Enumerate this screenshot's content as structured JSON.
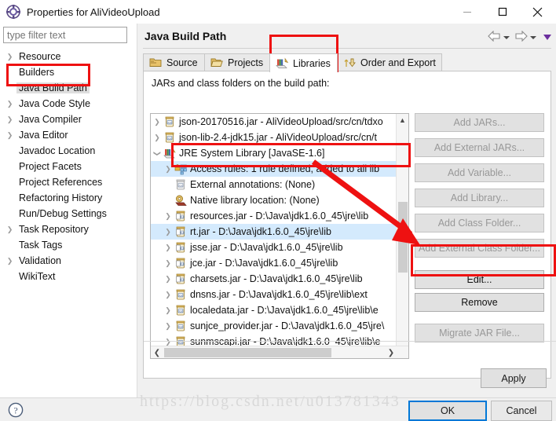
{
  "window": {
    "title": "Properties for AliVideoUpload",
    "icon": "eclipse-properties-icon",
    "minimize_label": "—",
    "maximize_label": "☐",
    "close_label": "✕"
  },
  "sidebar": {
    "filter": {
      "value": "",
      "placeholder": "type filter text"
    },
    "items": [
      {
        "label": "Resource",
        "expandable": true,
        "selected": false
      },
      {
        "label": "Builders",
        "expandable": false,
        "selected": false
      },
      {
        "label": "Java Build Path",
        "expandable": false,
        "selected": true
      },
      {
        "label": "Java Code Style",
        "expandable": true,
        "selected": false
      },
      {
        "label": "Java Compiler",
        "expandable": true,
        "selected": false
      },
      {
        "label": "Java Editor",
        "expandable": true,
        "selected": false
      },
      {
        "label": "Javadoc Location",
        "expandable": false,
        "selected": false
      },
      {
        "label": "Project Facets",
        "expandable": false,
        "selected": false
      },
      {
        "label": "Project References",
        "expandable": false,
        "selected": false
      },
      {
        "label": "Refactoring History",
        "expandable": false,
        "selected": false
      },
      {
        "label": "Run/Debug Settings",
        "expandable": false,
        "selected": false
      },
      {
        "label": "Task Repository",
        "expandable": true,
        "selected": false
      },
      {
        "label": "Task Tags",
        "expandable": false,
        "selected": false
      },
      {
        "label": "Validation",
        "expandable": true,
        "selected": false
      },
      {
        "label": "WikiText",
        "expandable": false,
        "selected": false
      }
    ]
  },
  "page": {
    "title": "Java Build Path",
    "nav": {
      "back_icon": "back-arrow-icon",
      "back_menu_icon": "chevron-down-icon",
      "forward_icon": "forward-arrow-icon",
      "forward_menu_icon": "chevron-down-icon",
      "menu_icon": "purple-triangle-icon"
    },
    "tabs": [
      {
        "label": "Source",
        "icon": "source-folder-icon",
        "active": false
      },
      {
        "label": "Projects",
        "icon": "projects-folder-icon",
        "active": false
      },
      {
        "label": "Libraries",
        "icon": "libraries-books-icon",
        "active": true
      },
      {
        "label": "Order and Export",
        "icon": "order-export-icon",
        "active": false
      }
    ],
    "panel_label": "JARs and class folders on the build path:",
    "list": [
      {
        "text": "json-20170516.jar - AliVideoUpload/src/cn/tdxo",
        "icon": "jar-icon",
        "expandable": true,
        "indent": 0,
        "highlight": false
      },
      {
        "text": "json-lib-2.4-jdk15.jar - AliVideoUpload/src/cn/t",
        "icon": "jar-icon",
        "expandable": true,
        "indent": 0,
        "highlight": false
      },
      {
        "text": "JRE System Library [JavaSE-1.6]",
        "icon": "library-icon",
        "expandable": true,
        "indent": 0,
        "highlight": false,
        "expanded": true
      },
      {
        "text": "Access rules: 1 rule defined, added to all lib",
        "icon": "access-rules-icon",
        "expandable": true,
        "indent": 1,
        "highlight": true
      },
      {
        "text": "External annotations: (None)",
        "icon": "annotations-icon",
        "expandable": false,
        "indent": 1,
        "highlight": false
      },
      {
        "text": "Native library location: (None)",
        "icon": "native-library-icon",
        "expandable": false,
        "indent": 1,
        "highlight": false
      },
      {
        "text": "resources.jar - D:\\Java\\jdk1.6.0_45\\jre\\lib",
        "icon": "jar-src-icon",
        "expandable": true,
        "indent": 1,
        "highlight": false
      },
      {
        "text": "rt.jar - D:\\Java\\jdk1.6.0_45\\jre\\lib",
        "icon": "jar-src-icon",
        "expandable": true,
        "indent": 1,
        "highlight": true
      },
      {
        "text": "jsse.jar - D:\\Java\\jdk1.6.0_45\\jre\\lib",
        "icon": "jar-src-icon",
        "expandable": true,
        "indent": 1,
        "highlight": false
      },
      {
        "text": "jce.jar - D:\\Java\\jdk1.6.0_45\\jre\\lib",
        "icon": "jar-src-icon",
        "expandable": true,
        "indent": 1,
        "highlight": false
      },
      {
        "text": "charsets.jar - D:\\Java\\jdk1.6.0_45\\jre\\lib",
        "icon": "jar-src-icon",
        "expandable": true,
        "indent": 1,
        "highlight": false
      },
      {
        "text": "dnsns.jar - D:\\Java\\jdk1.6.0_45\\jre\\lib\\ext",
        "icon": "jar-icon",
        "expandable": true,
        "indent": 1,
        "highlight": false
      },
      {
        "text": "localedata.jar - D:\\Java\\jdk1.6.0_45\\jre\\lib\\e",
        "icon": "jar-icon",
        "expandable": true,
        "indent": 1,
        "highlight": false
      },
      {
        "text": "sunjce_provider.jar - D:\\Java\\jdk1.6.0_45\\jre\\",
        "icon": "jar-icon",
        "expandable": true,
        "indent": 1,
        "highlight": false
      },
      {
        "text": "sunmscapi.jar - D:\\Java\\jdk1.6.0_45\\jre\\lib\\e",
        "icon": "jar-icon",
        "expandable": true,
        "indent": 1,
        "highlight": false
      }
    ],
    "side_buttons": [
      {
        "label": "Add JARs...",
        "enabled": false
      },
      {
        "label": "Add External JARs...",
        "enabled": false
      },
      {
        "label": "Add Variable...",
        "enabled": false
      },
      {
        "label": "Add Library...",
        "enabled": false
      },
      {
        "label": "Add Class Folder...",
        "enabled": false
      },
      {
        "label": "Add External Class Folder...",
        "enabled": false
      },
      {
        "label": "Edit...",
        "enabled": true
      },
      {
        "label": "Remove",
        "enabled": true
      },
      {
        "label": "Migrate JAR File...",
        "enabled": false
      }
    ],
    "apply_label": "Apply"
  },
  "footer": {
    "help_icon": "help-question-icon",
    "ok_label": "OK",
    "cancel_label": "Cancel"
  },
  "watermark": "https://blog.csdn.net/u013781343",
  "colors": {
    "annotation_red": "#ee1111",
    "selection_blue": "#d4eafd",
    "focus_blue": "#0078d7",
    "dialog_gray": "#f0f0f0"
  }
}
